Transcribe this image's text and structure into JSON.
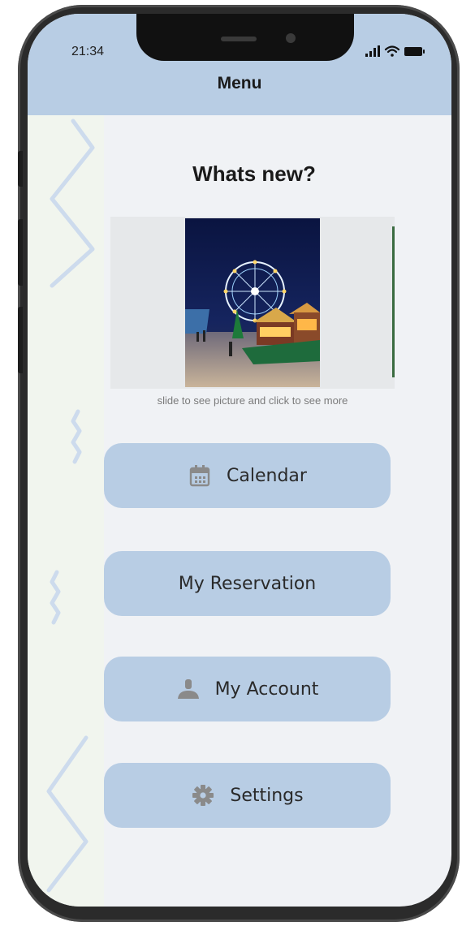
{
  "status_bar": {
    "time": "21:34",
    "icons": [
      "signal-icon",
      "wifi-icon",
      "battery-icon"
    ]
  },
  "header": {
    "title": "Menu"
  },
  "whats_new": {
    "heading": "Whats new?",
    "hint": "slide to see picture and click to see more",
    "image": "ferris-wheel-christmas-market-photo"
  },
  "menu": {
    "items": [
      {
        "label": "Calendar",
        "icon": "calendar-icon"
      },
      {
        "label": "My Reservation",
        "icon": ""
      },
      {
        "label": "My Account",
        "icon": "user-icon"
      },
      {
        "label": "Settings",
        "icon": "gear-icon"
      }
    ]
  },
  "colors": {
    "accent": "#b8cde4",
    "background": "#f0f2f5",
    "icon": "#8a8a8a"
  }
}
